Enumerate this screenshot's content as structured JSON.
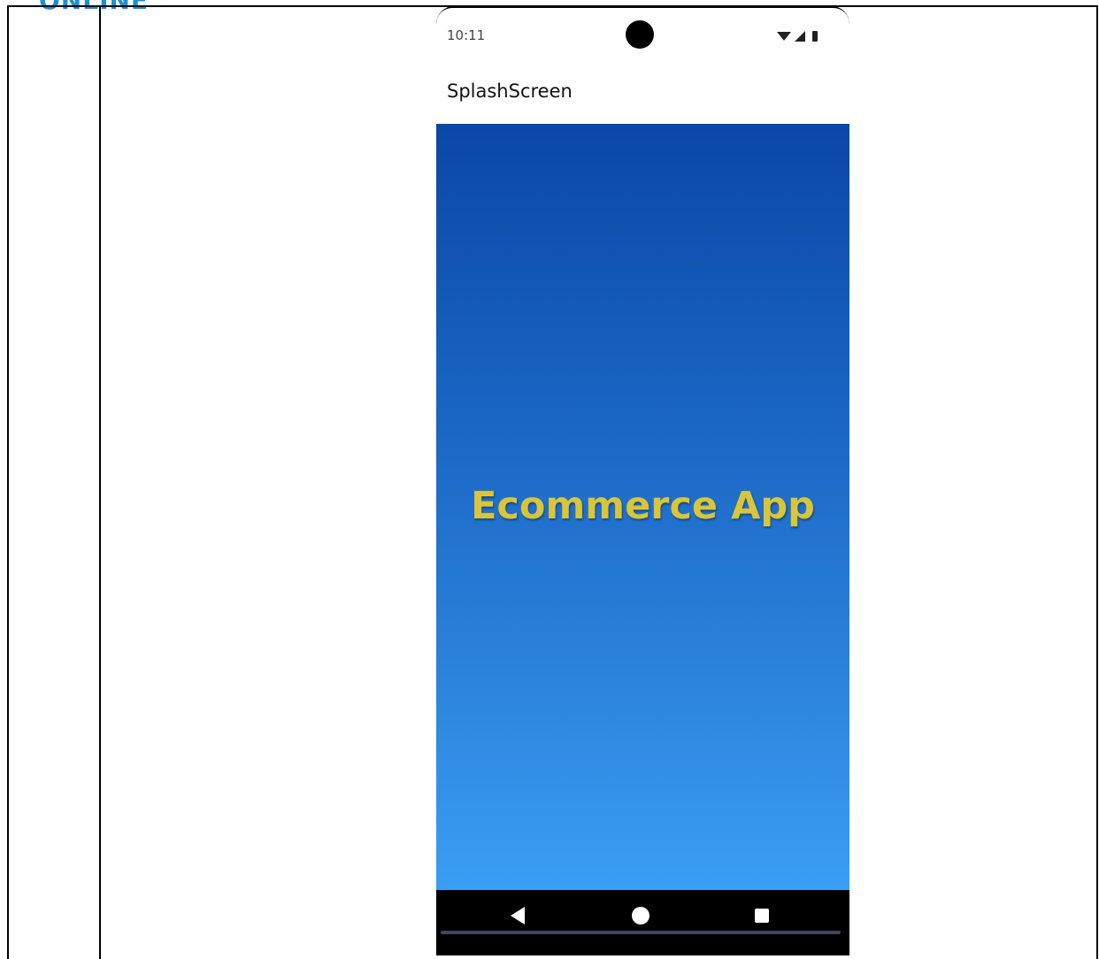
{
  "page": {
    "top_word": "ONLINE"
  },
  "phone": {
    "status_bar": {
      "time": "10:11",
      "icons": [
        "wifi-icon",
        "signal-icon",
        "battery-icon"
      ]
    },
    "app_bar": {
      "title": "SplashScreen"
    },
    "splash": {
      "title": "Ecommerce App",
      "title_color": "#d9c53a",
      "gradient_top": "#0b47a6",
      "gradient_bottom": "#3a9ef5"
    },
    "nav_bar": {
      "buttons": [
        "back-icon",
        "home-icon",
        "recent-apps-icon"
      ]
    }
  }
}
